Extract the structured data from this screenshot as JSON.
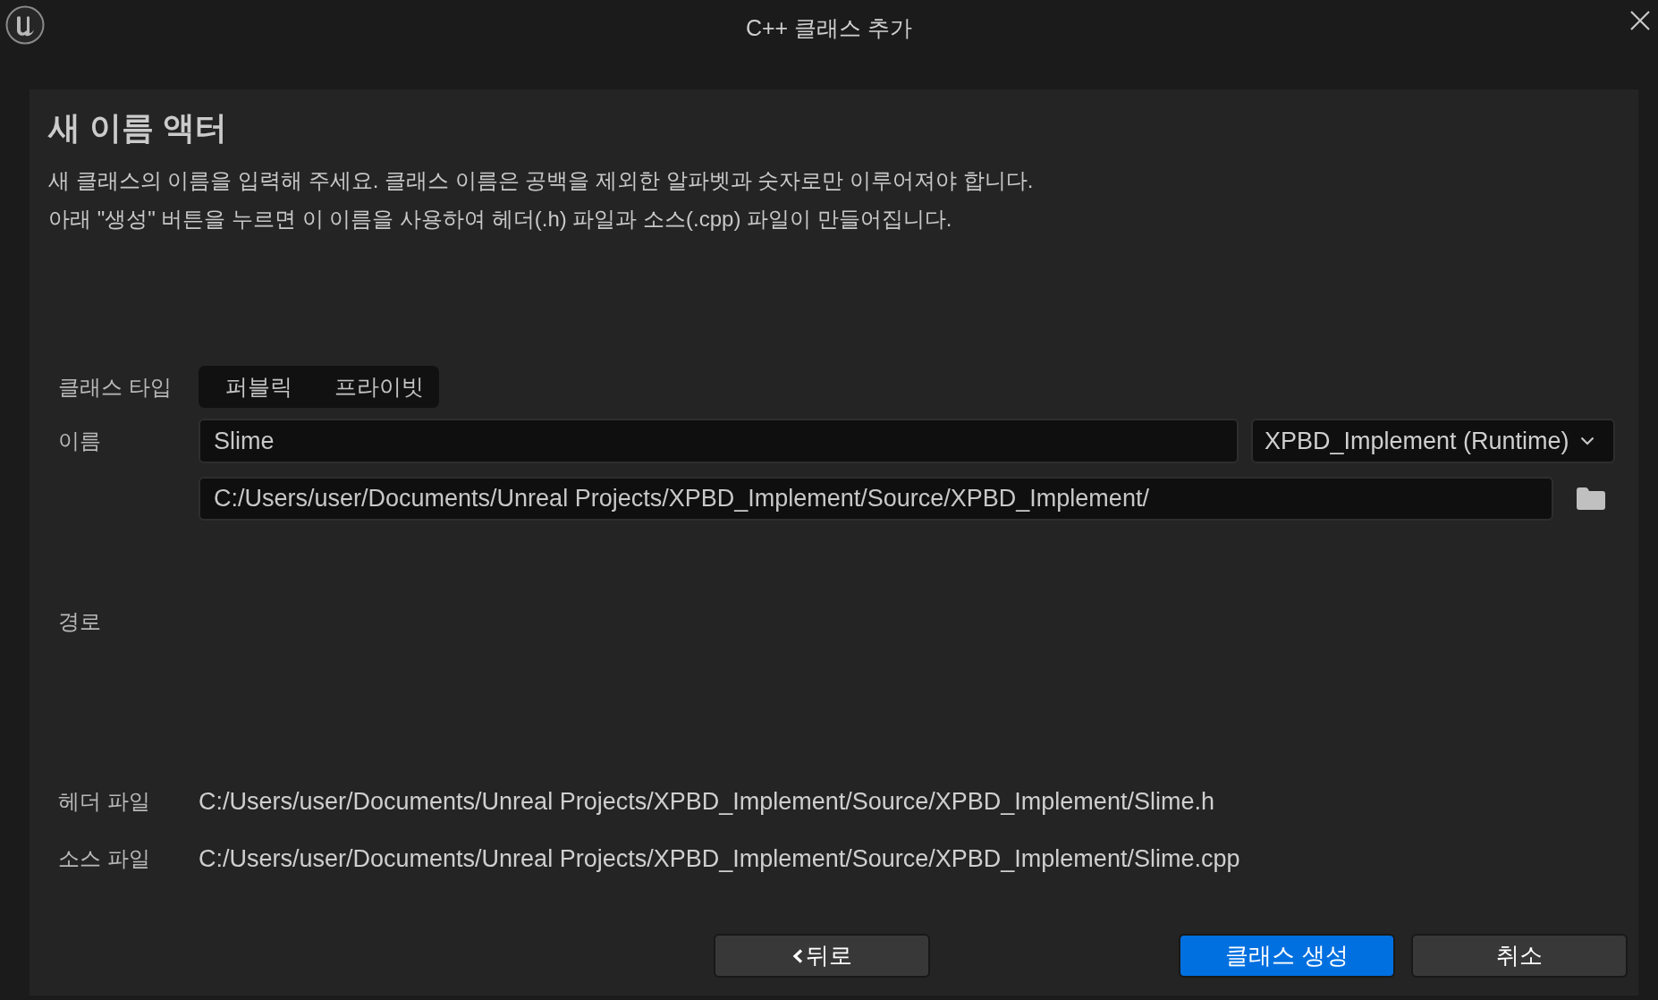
{
  "window": {
    "title": "C++ 클래스 추가"
  },
  "header": {
    "title": "새 이름 액터",
    "description": [
      "새 클래스의 이름을 입력해 주세요. 클래스 이름은 공백을 제외한 알파벳과 숫자로만 이루어져야 합니다.",
      "아래 \"생성\" 버튼을 누르면 이 이름을 사용하여 헤더(.h) 파일과 소스(.cpp) 파일이 만들어집니다."
    ]
  },
  "class_type": {
    "label": "클래스 타입",
    "options": [
      {
        "label": "퍼블릭",
        "selected": false
      },
      {
        "label": "프라이빗",
        "selected": false
      }
    ]
  },
  "name": {
    "label": "이름",
    "value": "Slime",
    "module": "XPBD_Implement (Runtime)"
  },
  "path": {
    "label": "경로",
    "value": "C:/Users/user/Documents/Unreal Projects/XPBD_Implement/Source/XPBD_Implement/"
  },
  "files": [
    {
      "label": "헤더 파일",
      "value": "C:/Users/user/Documents/Unreal Projects/XPBD_Implement/Source/XPBD_Implement/Slime.h"
    },
    {
      "label": "소스 파일",
      "value": "C:/Users/user/Documents/Unreal Projects/XPBD_Implement/Source/XPBD_Implement/Slime.cpp"
    }
  ],
  "buttons": [
    {
      "label": "뒤로",
      "kind": "back"
    },
    {
      "label": "클래스 생성",
      "kind": "primary"
    },
    {
      "label": "취소",
      "kind": "secondary"
    }
  ]
}
